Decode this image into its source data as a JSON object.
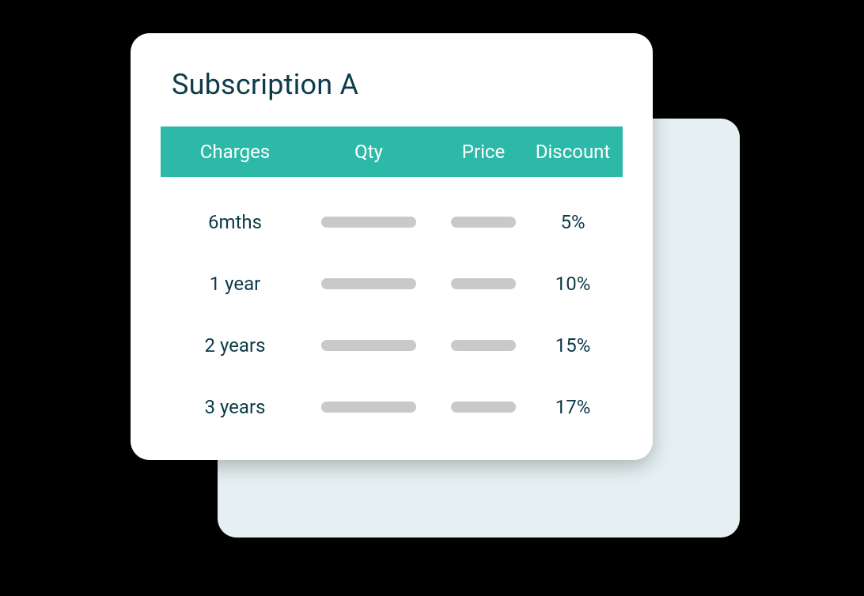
{
  "card": {
    "title": "Subscription A",
    "columns": {
      "charges": "Charges",
      "qty": "Qty",
      "price": "Price",
      "discount": "Discount"
    },
    "rows": [
      {
        "charges": "6mths",
        "discount": "5%"
      },
      {
        "charges": "1 year",
        "discount": "10%"
      },
      {
        "charges": "2 years",
        "discount": "15%"
      },
      {
        "charges": "3 years",
        "discount": "17%"
      }
    ]
  }
}
